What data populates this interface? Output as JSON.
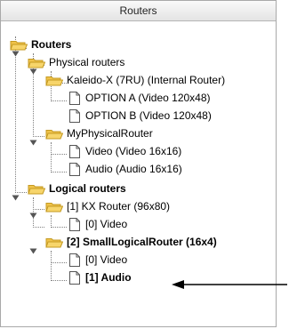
{
  "panel": {
    "header_title": "Routers"
  },
  "tree": {
    "root": "Routers",
    "physical_routers": "Physical routers",
    "kaleido": "Kaleido-X (7RU) (Internal Router)",
    "option_a": "OPTION A (Video 120x48)",
    "option_b": "OPTION B (Video 120x48)",
    "my_physical": "MyPhysicalRouter",
    "video_16": "Video (Video 16x16)",
    "audio_16": "Audio (Audio 16x16)",
    "logical_routers": "Logical routers",
    "kx_router": "[1] KX Router (96x80)",
    "kx_video": "[0] Video",
    "small_logical": "[2] SmallLogicalRouter (16x4)",
    "small_video": "[0] Video",
    "small_audio": "[1] Audio"
  },
  "colors": {
    "folder_fill": "#f7d56b",
    "folder_stroke": "#c49a22",
    "tree_line": "#808080",
    "arrow": "#000000"
  }
}
